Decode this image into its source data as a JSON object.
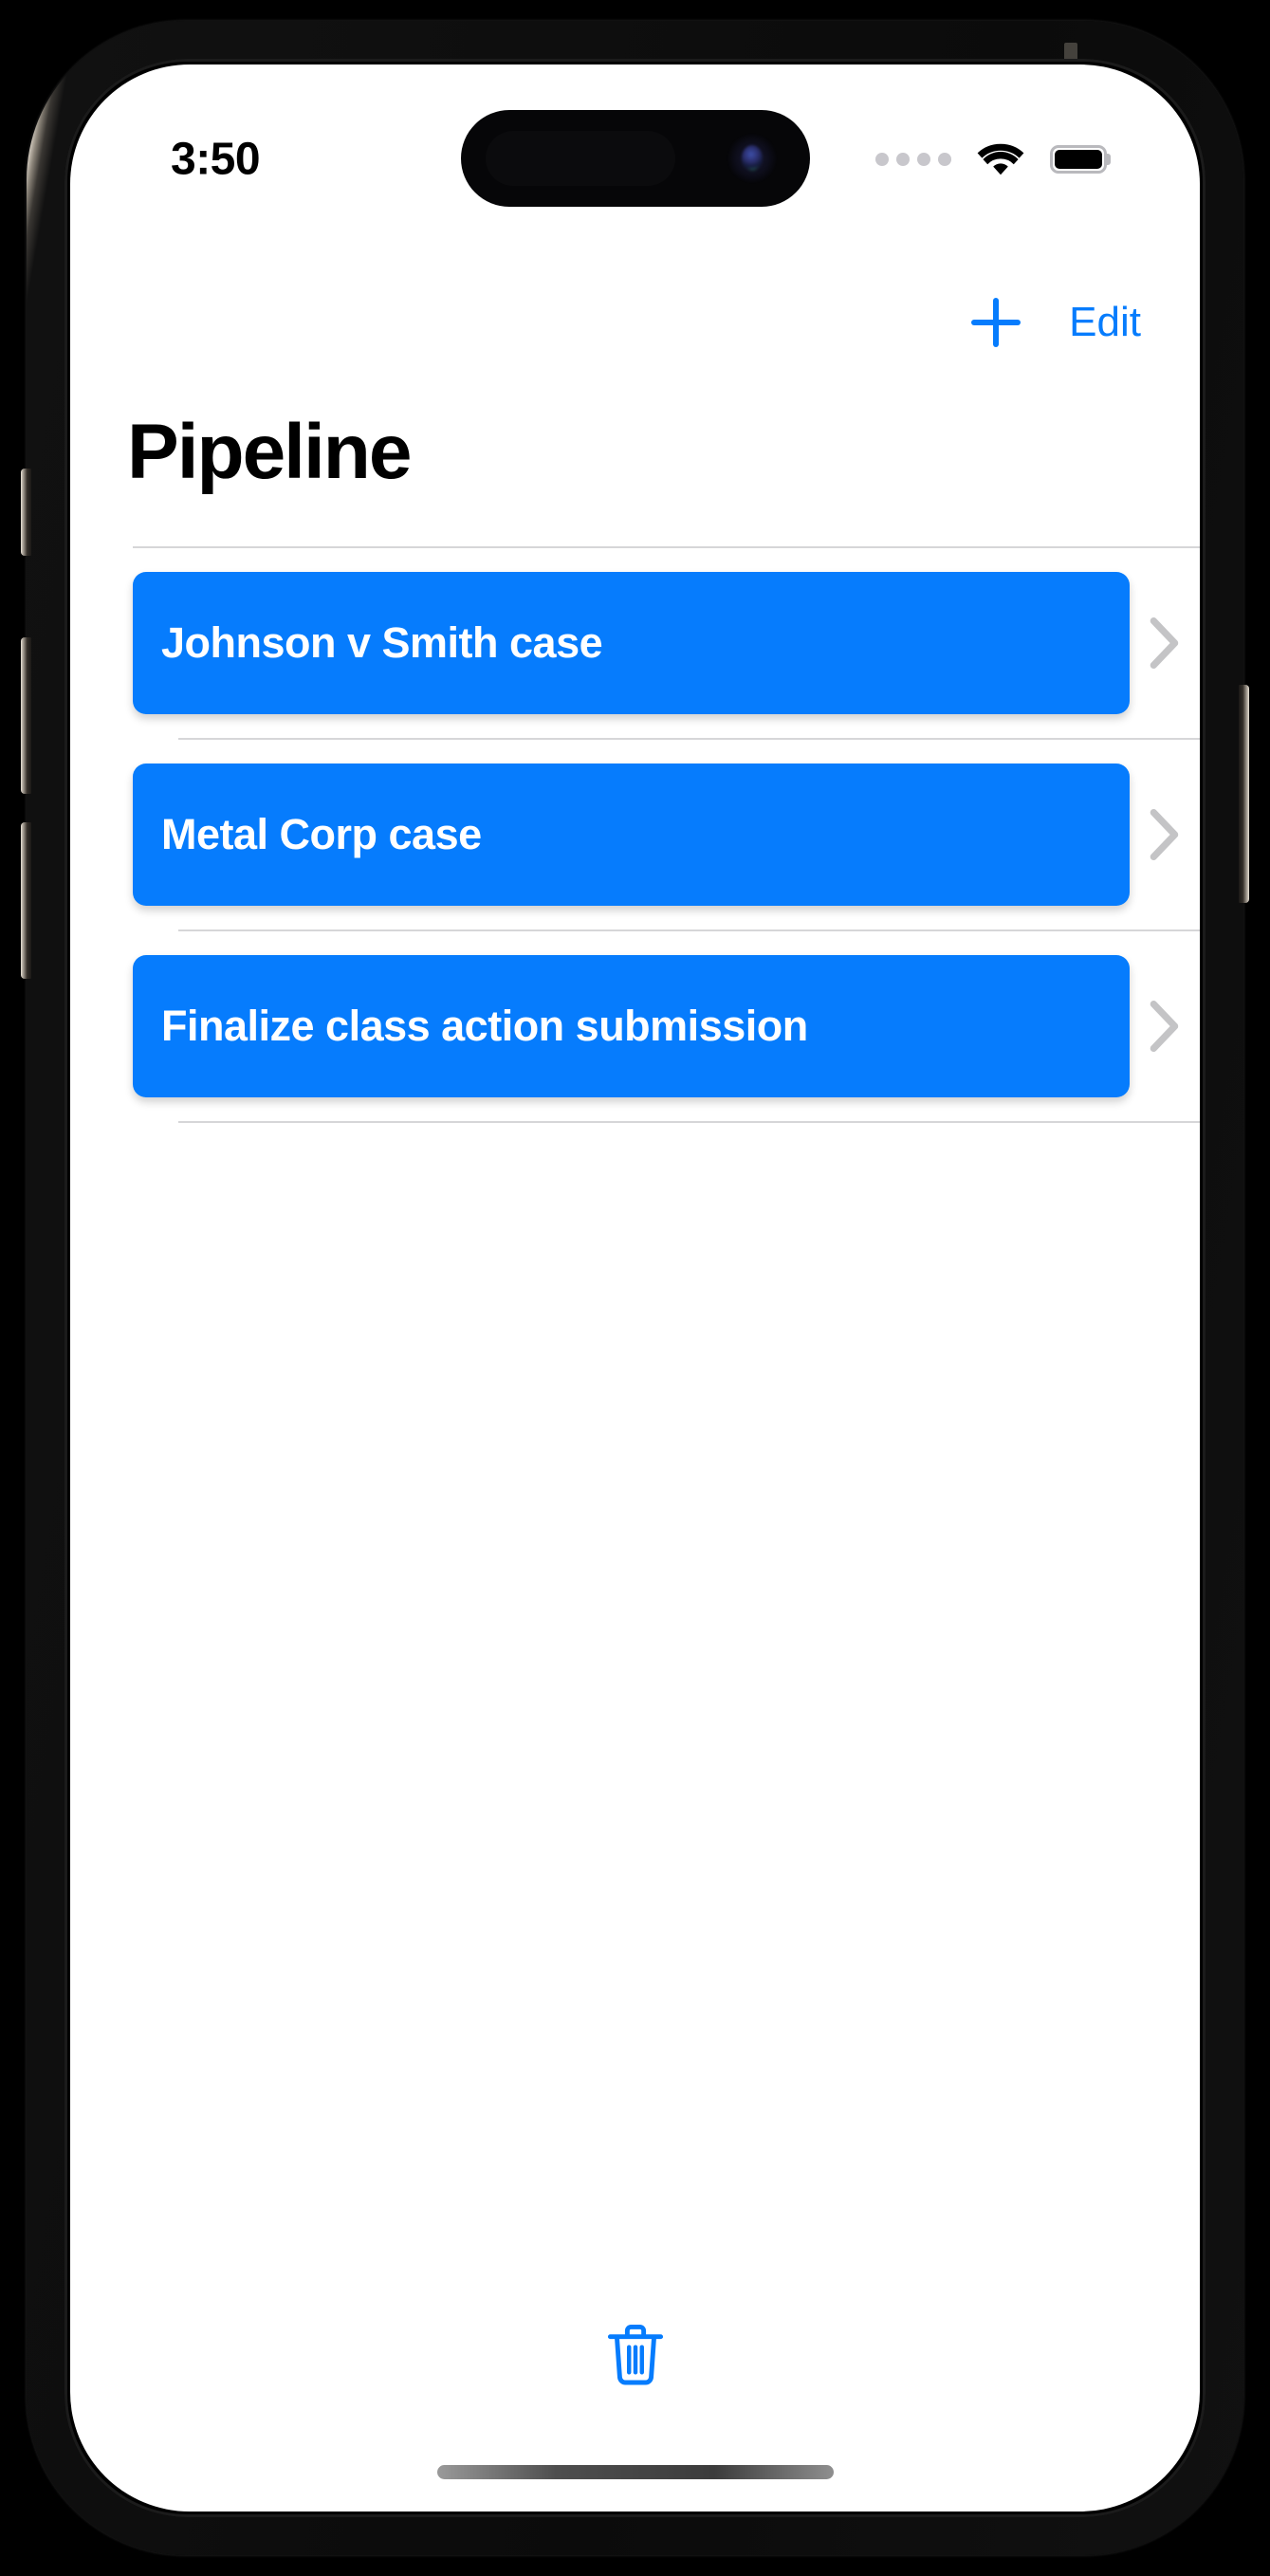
{
  "device": {
    "name": "iphone-15-pro",
    "frame_color": "#cfc7bb",
    "screen_background": "#FFFFFF"
  },
  "status_bar": {
    "time": "3:50",
    "cellular_icon": "cellular-dots-icon",
    "cellular_dots": 4,
    "wifi_icon": "wifi-icon",
    "battery_icon": "battery-icon",
    "battery_level_percent": 100
  },
  "nav_bar": {
    "add_label": "+",
    "add_icon": "plus-icon",
    "edit_label": "Edit"
  },
  "header": {
    "title": "Pipeline"
  },
  "colors": {
    "accent": "#067CFD",
    "row_text": "#FFFFFF",
    "separator": "#D6D6D8",
    "chevron": "#C4C4C6",
    "title_text": "#000000"
  },
  "list": {
    "items": [
      {
        "label": "Johnson v Smith case",
        "chevron_icon": "chevron-right-icon"
      },
      {
        "label": "Metal Corp case",
        "chevron_icon": "chevron-right-icon"
      },
      {
        "label": "Finalize class action submission",
        "chevron_icon": "chevron-right-icon"
      }
    ]
  },
  "toolbar": {
    "delete_icon": "trash-icon"
  }
}
